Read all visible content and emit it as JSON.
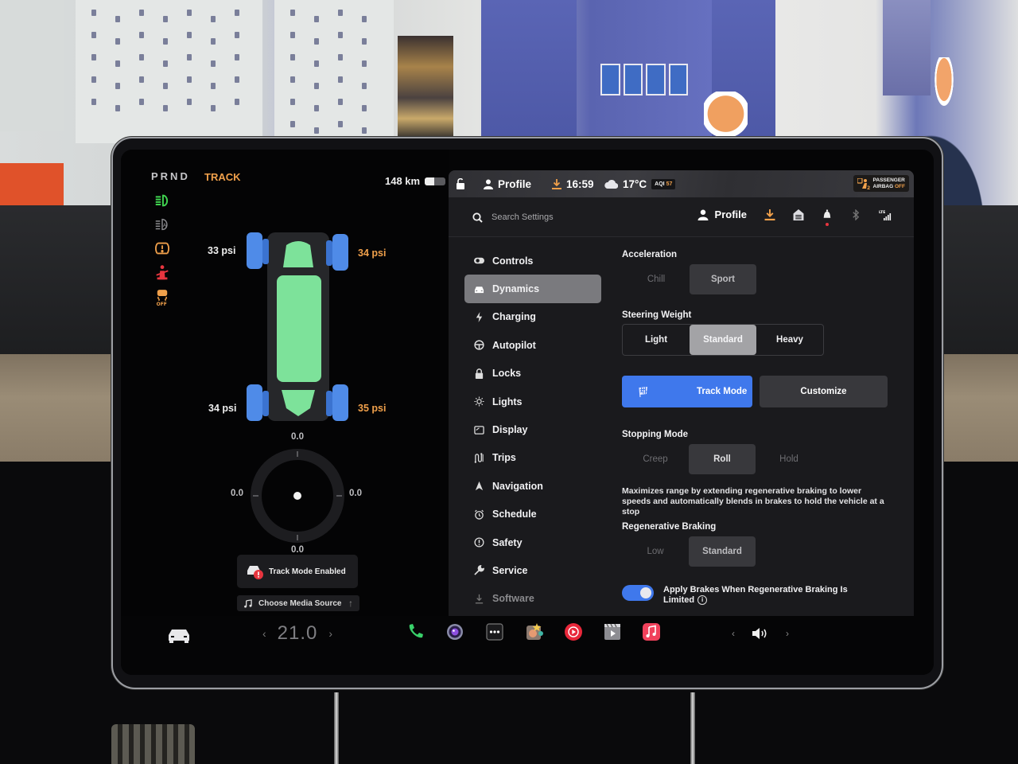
{
  "drive": {
    "gear": "PRND",
    "mode": "TRACK",
    "range": "148 km",
    "battery_level": 0.45,
    "telltales": [
      {
        "icon": "headlight-on-icon",
        "color": "#3fd14f"
      },
      {
        "icon": "auto-headlight-icon",
        "color": "#8a8a8e"
      },
      {
        "icon": "tire-pressure-warning-icon",
        "color": "#f0a04b"
      },
      {
        "icon": "seatbelt-warning-icon",
        "color": "#e8353f"
      },
      {
        "icon": "traction-control-off-icon",
        "color": "#f0a04b",
        "text": "OFF"
      }
    ],
    "tires": {
      "front_left": "33 psi",
      "front_right": "34 psi",
      "rear_left": "34 psi",
      "rear_right": "35 psi"
    },
    "g_meter": {
      "top": "0.0",
      "bottom": "0.0",
      "left": "0.0",
      "right": "0.0"
    },
    "notice": "Track Mode Enabled",
    "media_source": "Choose Media Source"
  },
  "statusbar": {
    "profile": "Profile",
    "time": "16:59",
    "temperature": "17°C",
    "aqi_label": "AQI",
    "aqi_value": "57",
    "airbag_line1": "PASSENGER",
    "airbag_line2": "AIRBAG",
    "airbag_state": "OFF"
  },
  "search": {
    "placeholder": "Search Settings"
  },
  "header": {
    "profile": "Profile"
  },
  "nav": {
    "items": [
      {
        "label": "Controls",
        "icon": "toggle-icon"
      },
      {
        "label": "Dynamics",
        "icon": "car-icon",
        "active": true
      },
      {
        "label": "Charging",
        "icon": "bolt-icon"
      },
      {
        "label": "Autopilot",
        "icon": "steering-wheel-icon"
      },
      {
        "label": "Locks",
        "icon": "lock-icon"
      },
      {
        "label": "Lights",
        "icon": "sun-icon"
      },
      {
        "label": "Display",
        "icon": "display-icon"
      },
      {
        "label": "Trips",
        "icon": "trips-icon"
      },
      {
        "label": "Navigation",
        "icon": "navigation-icon"
      },
      {
        "label": "Schedule",
        "icon": "alarm-clock-icon"
      },
      {
        "label": "Safety",
        "icon": "alert-circle-icon"
      },
      {
        "label": "Service",
        "icon": "wrench-icon"
      },
      {
        "label": "Software",
        "icon": "download-icon"
      }
    ]
  },
  "dynamics": {
    "acceleration": {
      "title": "Acceleration",
      "options": [
        "Chill",
        "Sport"
      ],
      "selected": "Sport"
    },
    "steering": {
      "title": "Steering Weight",
      "options": [
        "Light",
        "Standard",
        "Heavy"
      ],
      "selected": "Standard"
    },
    "track_mode_button": "Track Mode",
    "customize_button": "Customize",
    "stopping": {
      "title": "Stopping Mode",
      "options": [
        "Creep",
        "Roll",
        "Hold"
      ],
      "selected": "Roll"
    },
    "stopping_description": "Maximizes range by extending regenerative braking to lower speeds and automatically blends in brakes to hold the vehicle at a stop",
    "regen": {
      "title": "Regenerative Braking",
      "options": [
        "Low",
        "Standard"
      ],
      "selected": "Standard"
    },
    "apply_brakes_label": "Apply Brakes When Regenerative Braking Is Limited",
    "apply_brakes_enabled": true
  },
  "dock": {
    "cabin_temperature": "21.0",
    "apps": [
      "phone-icon",
      "camera-icon",
      "more-apps-icon",
      "toybox-icon",
      "youtube-music-icon",
      "theater-icon",
      "apple-music-icon"
    ]
  },
  "colors": {
    "accent": "#3f78ec",
    "warning": "#f0a04b",
    "alert": "#e8353f",
    "ok": "#3fd14f",
    "chassis": "#7de29a",
    "tires": "#4f8be8"
  }
}
